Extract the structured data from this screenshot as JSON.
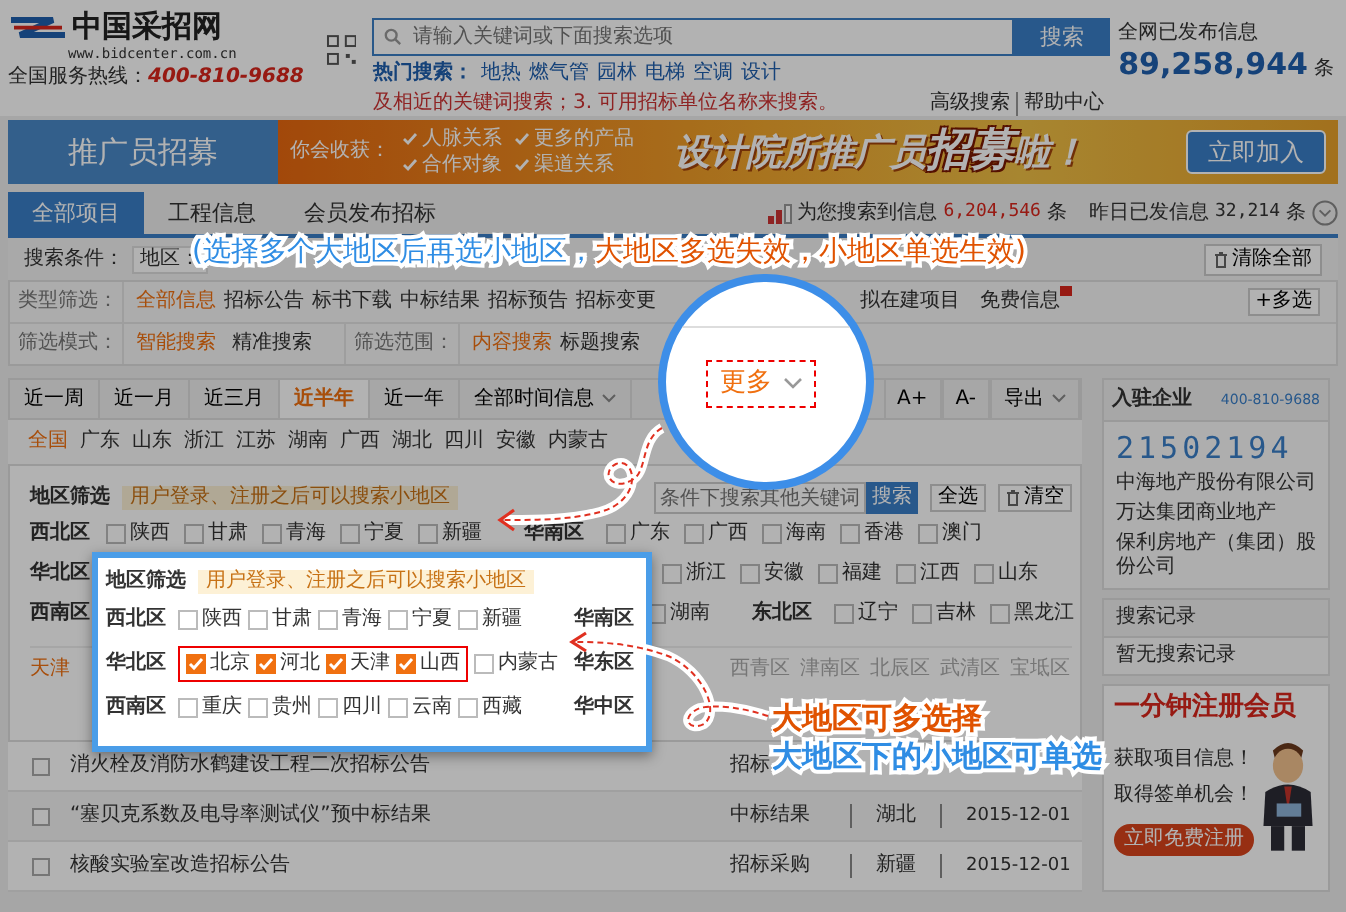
{
  "header": {
    "logo": {
      "name": "中国采招网",
      "domain": "www.bidcenter.com.cn"
    },
    "hotline_label": "全国服务热线：",
    "hotline": "400-810-9688",
    "search": {
      "placeholder": "请输入关键词或下面搜索选项",
      "button": "搜索"
    },
    "hot_label": "热门搜索：",
    "hot_searches": [
      "地热",
      "燃气管",
      "园林",
      "电梯",
      "空调",
      "设计"
    ],
    "search_tip": "及相近的关键词搜索；3. 可用招标单位名称来搜索。",
    "links": [
      "高级搜索",
      "帮助中心"
    ],
    "stats": {
      "label": "全网已发布信息",
      "value": "89,258,944",
      "unit": "条"
    }
  },
  "banner": {
    "title": "推广员招募",
    "gains_label": "你会收获：",
    "gains": [
      "人脉关系",
      "更多的产品",
      "合作对象",
      "渠道关系"
    ],
    "slogan": [
      {
        "text": "设计院所推广员",
        "kind": "plain"
      },
      {
        "text": "招募",
        "kind": "accent"
      },
      {
        "text": "啦！",
        "kind": "plain"
      }
    ],
    "button": "立即加入"
  },
  "tabs": [
    {
      "label": "全部项目",
      "selected": true
    },
    {
      "label": "工程信息",
      "selected": false
    },
    {
      "label": "会员发布招标",
      "selected": false
    }
  ],
  "result_summary": {
    "found_label": "为您搜索到信息",
    "found": "6,204,546",
    "found_unit": "条",
    "yesterday_label": "昨日已发信息",
    "yesterday": "32,214",
    "yesterday_unit": "条"
  },
  "note": [
    {
      "text": "(选择多个大地区后再选小地区，",
      "kind": "info"
    },
    {
      "text": "大地区多选失效，小地区单选生效)",
      "kind": "warn"
    }
  ],
  "conditions": {
    "label": "搜索条件：",
    "region_label": "地区：",
    "clear_button": "清除全部"
  },
  "type_filter": {
    "label": "类型筛选：",
    "items": [
      {
        "label": "全部信息",
        "selected": true
      },
      {
        "label": "招标公告",
        "selected": false
      },
      {
        "label": "标书下载",
        "selected": false
      },
      {
        "label": "中标结果",
        "selected": false
      },
      {
        "label": "招标预告",
        "selected": false
      },
      {
        "label": "招标变更",
        "selected": false
      },
      {
        "label": "拟在建项目",
        "selected": false
      },
      {
        "label": "免费信息",
        "selected": false,
        "badge": true
      }
    ],
    "multi_button": "+多选"
  },
  "mode_filter": {
    "label": "筛选模式：",
    "items": [
      {
        "label": "智能搜索",
        "selected": true
      },
      {
        "label": "精准搜索",
        "selected": false
      }
    ]
  },
  "scope_filter": {
    "label": "筛选范围：",
    "items": [
      {
        "label": "内容搜索",
        "selected": true
      },
      {
        "label": "标题搜索",
        "selected": false
      }
    ]
  },
  "time_tabs": [
    {
      "label": "近一周",
      "selected": false
    },
    {
      "label": "近一月",
      "selected": false
    },
    {
      "label": "近三月",
      "selected": false
    },
    {
      "label": "近半年",
      "selected": true
    },
    {
      "label": "近一年",
      "selected": false
    }
  ],
  "info_dropdown": "全部时间信息",
  "more_button": "更多",
  "font_buttons": [
    "A+",
    "A-"
  ],
  "export_button": "导出",
  "provinces": [
    {
      "label": "全国",
      "selected": true
    },
    {
      "label": "广东",
      "selected": false
    },
    {
      "label": "山东",
      "selected": false
    },
    {
      "label": "浙江",
      "selected": false
    },
    {
      "label": "江苏",
      "selected": false
    },
    {
      "label": "湖南",
      "selected": false
    },
    {
      "label": "广西",
      "selected": false
    },
    {
      "label": "湖北",
      "selected": false
    },
    {
      "label": "四川",
      "selected": false
    },
    {
      "label": "安徽",
      "selected": false
    },
    {
      "label": "内蒙古",
      "selected": false
    }
  ],
  "keyword_search": {
    "placeholder": "条件下搜索其他关键词",
    "button": "搜索"
  },
  "region_panel": {
    "title": "地区筛选",
    "tip": "用户登录、注册之后可以搜索小地区",
    "select_all": "全选",
    "clear": "清空",
    "rows": [
      {
        "kind": "full",
        "label": "西北区",
        "groups": [
          {
            "items": [
              {
                "label": "陕西",
                "checked": false
              },
              {
                "label": "甘肃",
                "checked": false
              },
              {
                "label": "青海",
                "checked": false
              },
              {
                "label": "宁夏",
                "checked": false
              },
              {
                "label": "新疆",
                "checked": false
              }
            ]
          },
          {
            "label": "华南区",
            "items": [
              {
                "label": "广东",
                "checked": false
              },
              {
                "label": "广西",
                "checked": false
              },
              {
                "label": "海南",
                "checked": false
              },
              {
                "label": "香港",
                "checked": false
              },
              {
                "label": "澳门",
                "checked": false
              }
            ]
          }
        ]
      },
      {
        "kind": "tail",
        "label": "华北区",
        "groups": [
          {
            "items": [
              {
                "label": "浙江",
                "checked": false
              },
              {
                "label": "安徽",
                "checked": false
              },
              {
                "label": "福建",
                "checked": false
              },
              {
                "label": "江西",
                "checked": false
              },
              {
                "label": "山东",
                "checked": false
              }
            ]
          }
        ]
      },
      {
        "kind": "tail",
        "label": "西南区",
        "groups": [
          {
            "items": [
              {
                "label": "湖南",
                "checked": false
              }
            ]
          },
          {
            "label": "东北区",
            "items": [
              {
                "label": "辽宁",
                "checked": false
              },
              {
                "label": "吉林",
                "checked": false
              },
              {
                "label": "黑龙江",
                "checked": false
              }
            ]
          }
        ]
      }
    ],
    "subregion": {
      "city": "天津",
      "districts": [
        "西青区",
        "津南区",
        "北辰区",
        "武清区",
        "宝坻区"
      ]
    }
  },
  "popup": {
    "title": "地区筛选",
    "tip": "用户登录、注册之后可以搜索小地区",
    "rows": [
      {
        "label": "西北区",
        "next": "华南区",
        "items": [
          {
            "label": "陕西",
            "checked": false
          },
          {
            "label": "甘肃",
            "checked": false
          },
          {
            "label": "青海",
            "checked": false
          },
          {
            "label": "宁夏",
            "checked": false
          },
          {
            "label": "新疆",
            "checked": false
          }
        ]
      },
      {
        "label": "华北区",
        "next": "华东区",
        "items": [
          {
            "label": "北京",
            "checked": true
          },
          {
            "label": "河北",
            "checked": true
          },
          {
            "label": "天津",
            "checked": true
          },
          {
            "label": "山西",
            "checked": true
          },
          {
            "label": "内蒙古",
            "checked": false
          }
        ]
      },
      {
        "label": "西南区",
        "next": "华中区",
        "items": [
          {
            "label": "重庆",
            "checked": false
          },
          {
            "label": "贵州",
            "checked": false
          },
          {
            "label": "四川",
            "checked": false
          },
          {
            "label": "云南",
            "checked": false
          },
          {
            "label": "西藏",
            "checked": false
          }
        ]
      }
    ]
  },
  "callouts": [
    {
      "text": "大地区可多选择",
      "kind": "warn"
    },
    {
      "text": "大地区下的小地区可单选",
      "kind": "info"
    }
  ],
  "results": [
    {
      "title": "消火栓及消防水鹤建设工程二次招标公告",
      "type": "招标",
      "checked": false
    },
    {
      "title": "“塞贝克系数及电导率测试仪”预中标结果",
      "type": "中标结果",
      "region": "湖北",
      "date": "2015-12-01",
      "checked": false
    },
    {
      "title": "核酸实验室改造招标公告",
      "type": "招标采购",
      "region": "新疆",
      "date": "2015-12-01",
      "checked": false
    }
  ],
  "sidebar": {
    "title": "入驻企业",
    "phone": "400-810-9688",
    "counter": "21502194",
    "companies": [
      "中海地产股份有限公司",
      "万达集团商业地产",
      "保利房地产（集团）股份公司"
    ],
    "history_title": "搜索记录",
    "history_empty": "暂无搜索记录",
    "ad": {
      "title": "一分钟注册会员",
      "lines": [
        "获取项目信息！",
        "取得签单机会！"
      ],
      "button": "立即免费注册"
    }
  }
}
